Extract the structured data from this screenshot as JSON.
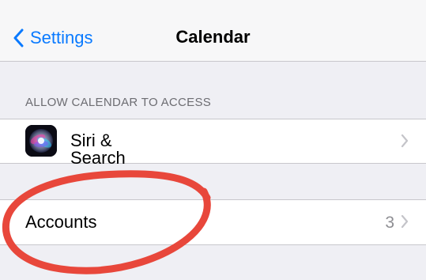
{
  "navbar": {
    "back_label": "Settings",
    "title": "Calendar"
  },
  "section": {
    "header": "ALLOW CALENDAR TO ACCESS"
  },
  "rows": {
    "siri": {
      "label": "Siri & Search",
      "icon": "siri-icon"
    },
    "accounts": {
      "label": "Accounts",
      "detail": "3"
    }
  },
  "colors": {
    "accent": "#0a7aff",
    "annotation": "#e8473b",
    "background": "#efeff4",
    "secondary_text": "#8e8e93"
  }
}
